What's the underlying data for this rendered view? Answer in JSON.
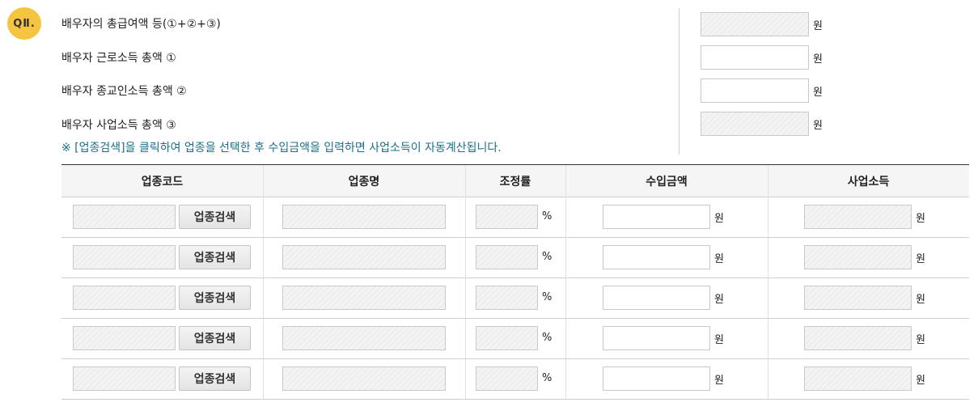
{
  "section": {
    "badge": "QⅡ."
  },
  "fields": {
    "total": {
      "label": "배우자의 총급여액 등(①+②+③)",
      "unit": "원"
    },
    "labor": {
      "label": "배우자 근로소득 총액 ①",
      "unit": "원"
    },
    "religious": {
      "label": "배우자 종교인소득 총액 ②",
      "unit": "원"
    },
    "business": {
      "label": "배우자 사업소득 총액 ③",
      "unit": "원"
    }
  },
  "note": {
    "mark": "※",
    "text": " [업종검색]을 클릭하여 업종을 선택한 후 수입금액을 입력하면 사업소득이 자동계산됩니다."
  },
  "table": {
    "headers": [
      "업종코드",
      "업종명",
      "조정률",
      "수입금액",
      "사업소득"
    ],
    "search_label": "업종검색",
    "percent_unit": "%",
    "won_unit": "원"
  }
}
